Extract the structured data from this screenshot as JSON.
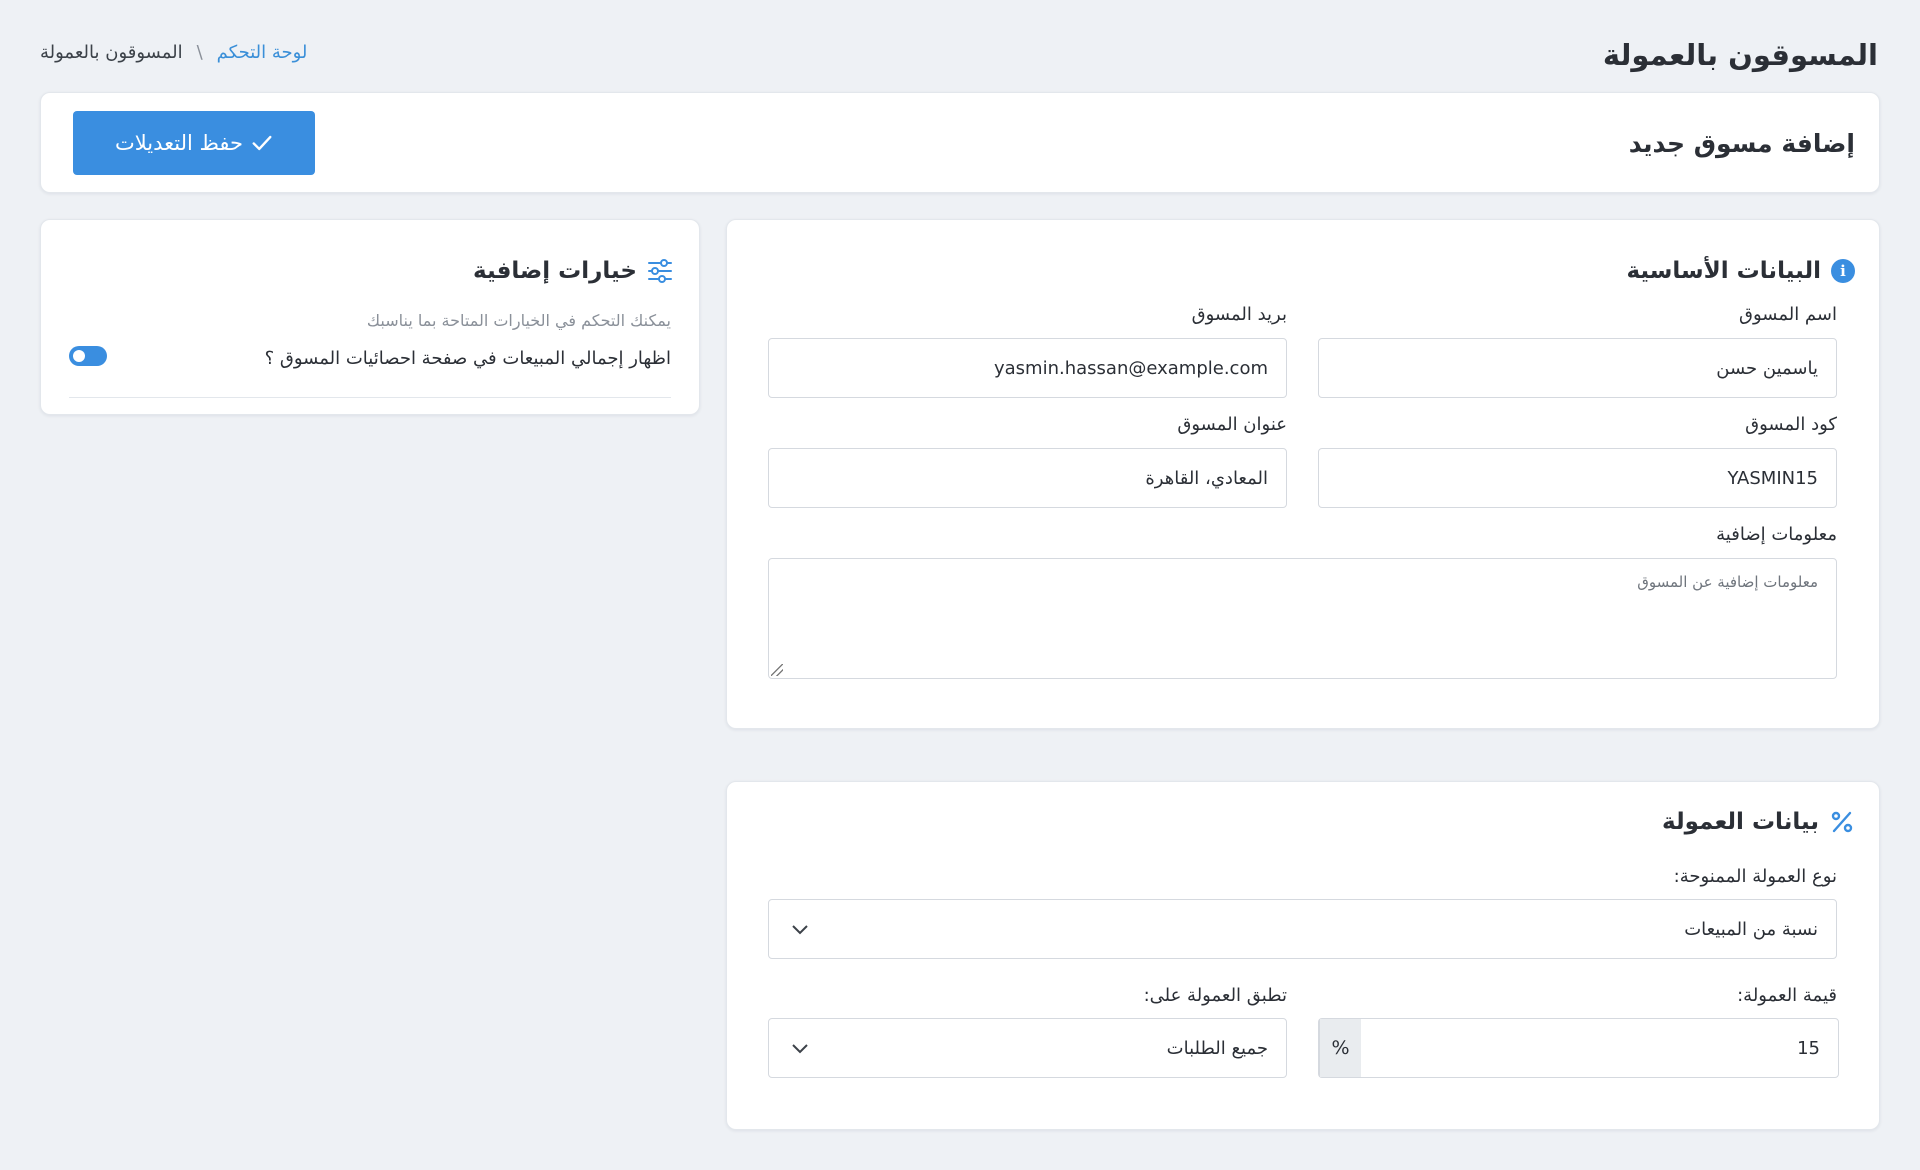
{
  "page": {
    "title": "المسوقون بالعمولة",
    "breadcrumb": {
      "home": "لوحة التحكم",
      "separator": "\\",
      "current": "المسوقون بالعمولة"
    }
  },
  "header": {
    "title": "إضافة مسوق جديد",
    "save_label": "حفظ التعديلات"
  },
  "basic": {
    "title": "البيانات الأساسية",
    "icon": "info-icon",
    "name_label": "اسم المسوق",
    "name_value": "ياسمين حسن",
    "email_label": "بريد المسوق",
    "email_value": "yasmin.hassan@example.com",
    "code_label": "كود المسوق",
    "code_value": "YASMIN15",
    "address_label": "عنوان المسوق",
    "address_value": "المعادي، القاهرة",
    "info_label": "معلومات إضافية",
    "info_placeholder": "معلومات إضافية عن المسوق"
  },
  "options": {
    "title": "خيارات إضافية",
    "icon": "sliders-icon",
    "subtitle": "يمكنك التحكم في الخيارات المتاحة بما يناسبك",
    "toggle_label": "اظهار إجمالي المبيعات في صفحة احصائيات المسوق ؟",
    "toggle_on": true
  },
  "commission": {
    "title": "بيانات العمولة",
    "icon": "percent-icon",
    "type_label": "نوع العمولة الممنوحة:",
    "type_value": "نسبة من المبيعات",
    "value_label": "قيمة العمولة:",
    "value": "15",
    "value_unit": "%",
    "applies_label": "تطبق العمولة على:",
    "applies_value": "جميع الطلبات"
  },
  "colors": {
    "accent": "#3a8ee0",
    "background": "#eef1f5",
    "link": "#3a8fd8"
  }
}
